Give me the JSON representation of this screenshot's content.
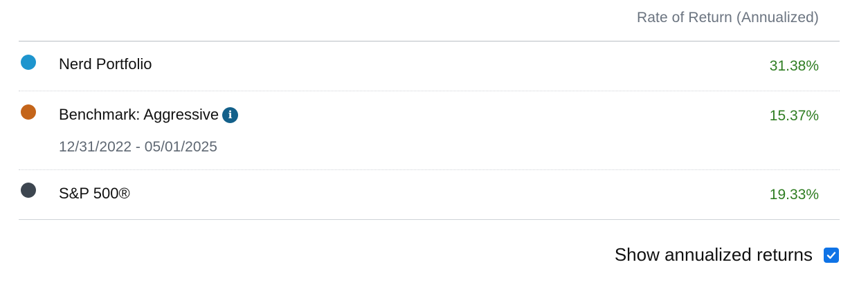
{
  "header": {
    "column_label": "Rate of Return (Annualized)"
  },
  "rows": [
    {
      "name": "Nerd Portfolio",
      "value": "31.38%",
      "dot_color": "#1e95ce"
    },
    {
      "name": "Benchmark: Aggressive",
      "info_icon": "i",
      "date_range": "12/31/2022 - 05/01/2025",
      "value": "15.37%",
      "dot_color": "#c4651a"
    },
    {
      "name": "S&P 500®",
      "value": "19.33%",
      "dot_color": "#3d4650"
    }
  ],
  "footer": {
    "toggle_label": "Show annualized returns",
    "toggle_checked": true
  },
  "colors": {
    "positive_value": "#2f7d22",
    "checkbox_accent": "#0f73e6",
    "info_icon": "#13608a"
  }
}
